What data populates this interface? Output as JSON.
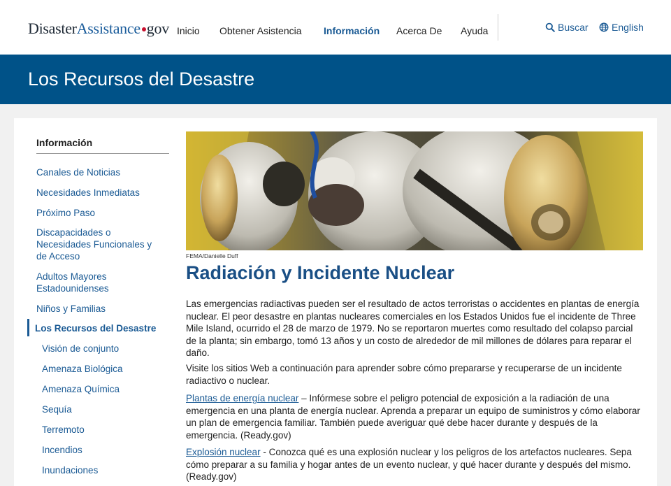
{
  "header": {
    "logo": {
      "part1": "Disaster",
      "part2": "Assistance",
      "part3": "gov"
    },
    "nav": [
      {
        "label": "Inicio",
        "active": false
      },
      {
        "label": "Obtener Asistencia",
        "active": false
      },
      {
        "label": "Información",
        "active": true
      },
      {
        "label": "Acerca De",
        "active": false
      },
      {
        "label": "Ayuda",
        "active": false
      }
    ],
    "search_label": "Buscar",
    "language_label": "English"
  },
  "banner": {
    "title": "Los Recursos del Desastre"
  },
  "sidebar": {
    "heading": "Información",
    "items": [
      {
        "label": "Canales de Noticias"
      },
      {
        "label": "Necesidades Inmediatas"
      },
      {
        "label": "Próximo Paso"
      },
      {
        "label": "Discapacidades o Necesidades Funcionales y de Acceso"
      },
      {
        "label": "Adultos Mayores Estadounidenses"
      },
      {
        "label": "Niños y Familias"
      },
      {
        "label": "Los Recursos del Desastre"
      }
    ],
    "subitems": [
      {
        "label": "Visión de conjunto"
      },
      {
        "label": "Amenaza Biológica"
      },
      {
        "label": "Amenaza Química"
      },
      {
        "label": "Sequía"
      },
      {
        "label": "Terremoto"
      },
      {
        "label": "Incendios"
      },
      {
        "label": "Inundaciones"
      }
    ]
  },
  "article": {
    "image_credit": "FEMA/Danielle Duff",
    "title": "Radiación y Incidente Nuclear",
    "intro": "Las emergencias radiactivas pueden ser el resultado de actos terroristas o accidentes en plantas de energía nuclear. El peor desastre en plantas nucleares comerciales en los Estados Unidos fue el incidente de Three Mile Island, ocurrido el 28 de marzo de 1979. No se reportaron muertes como resultado del colapso parcial de la planta; sin embargo, tomó 13 años y un costo de alrededor de mil millones de dólares para reparar el daño.",
    "visit": "Visite los sitios Web a continuación para aprender sobre cómo prepararse y recuperarse de un incidente radiactivo o nuclear.",
    "link1": {
      "label": "Plantas de energía nuclear",
      "text": " – Infórmese sobre el peligro potencial de exposición a la radiación de una emergencia en una planta de energía nuclear. Aprenda a preparar un equipo de suministros y cómo elaborar un plan de emergencia familiar. También puede averiguar qué debe hacer durante y después de la emergencia. (Ready.gov)"
    },
    "link2": {
      "label": "Explosión nuclear",
      "text": " - Conozca qué es una explosión nuclear y los peligros de los artefactos nucleares. Sepa cómo preparar a su familia y hogar antes de un evento nuclear, y qué hacer durante y después del mismo. (Ready.gov)"
    }
  },
  "colors": {
    "brand_blue": "#005288",
    "link_blue": "#1a5a94",
    "title_blue": "#1a4f85",
    "logo_red": "#c8102e"
  }
}
